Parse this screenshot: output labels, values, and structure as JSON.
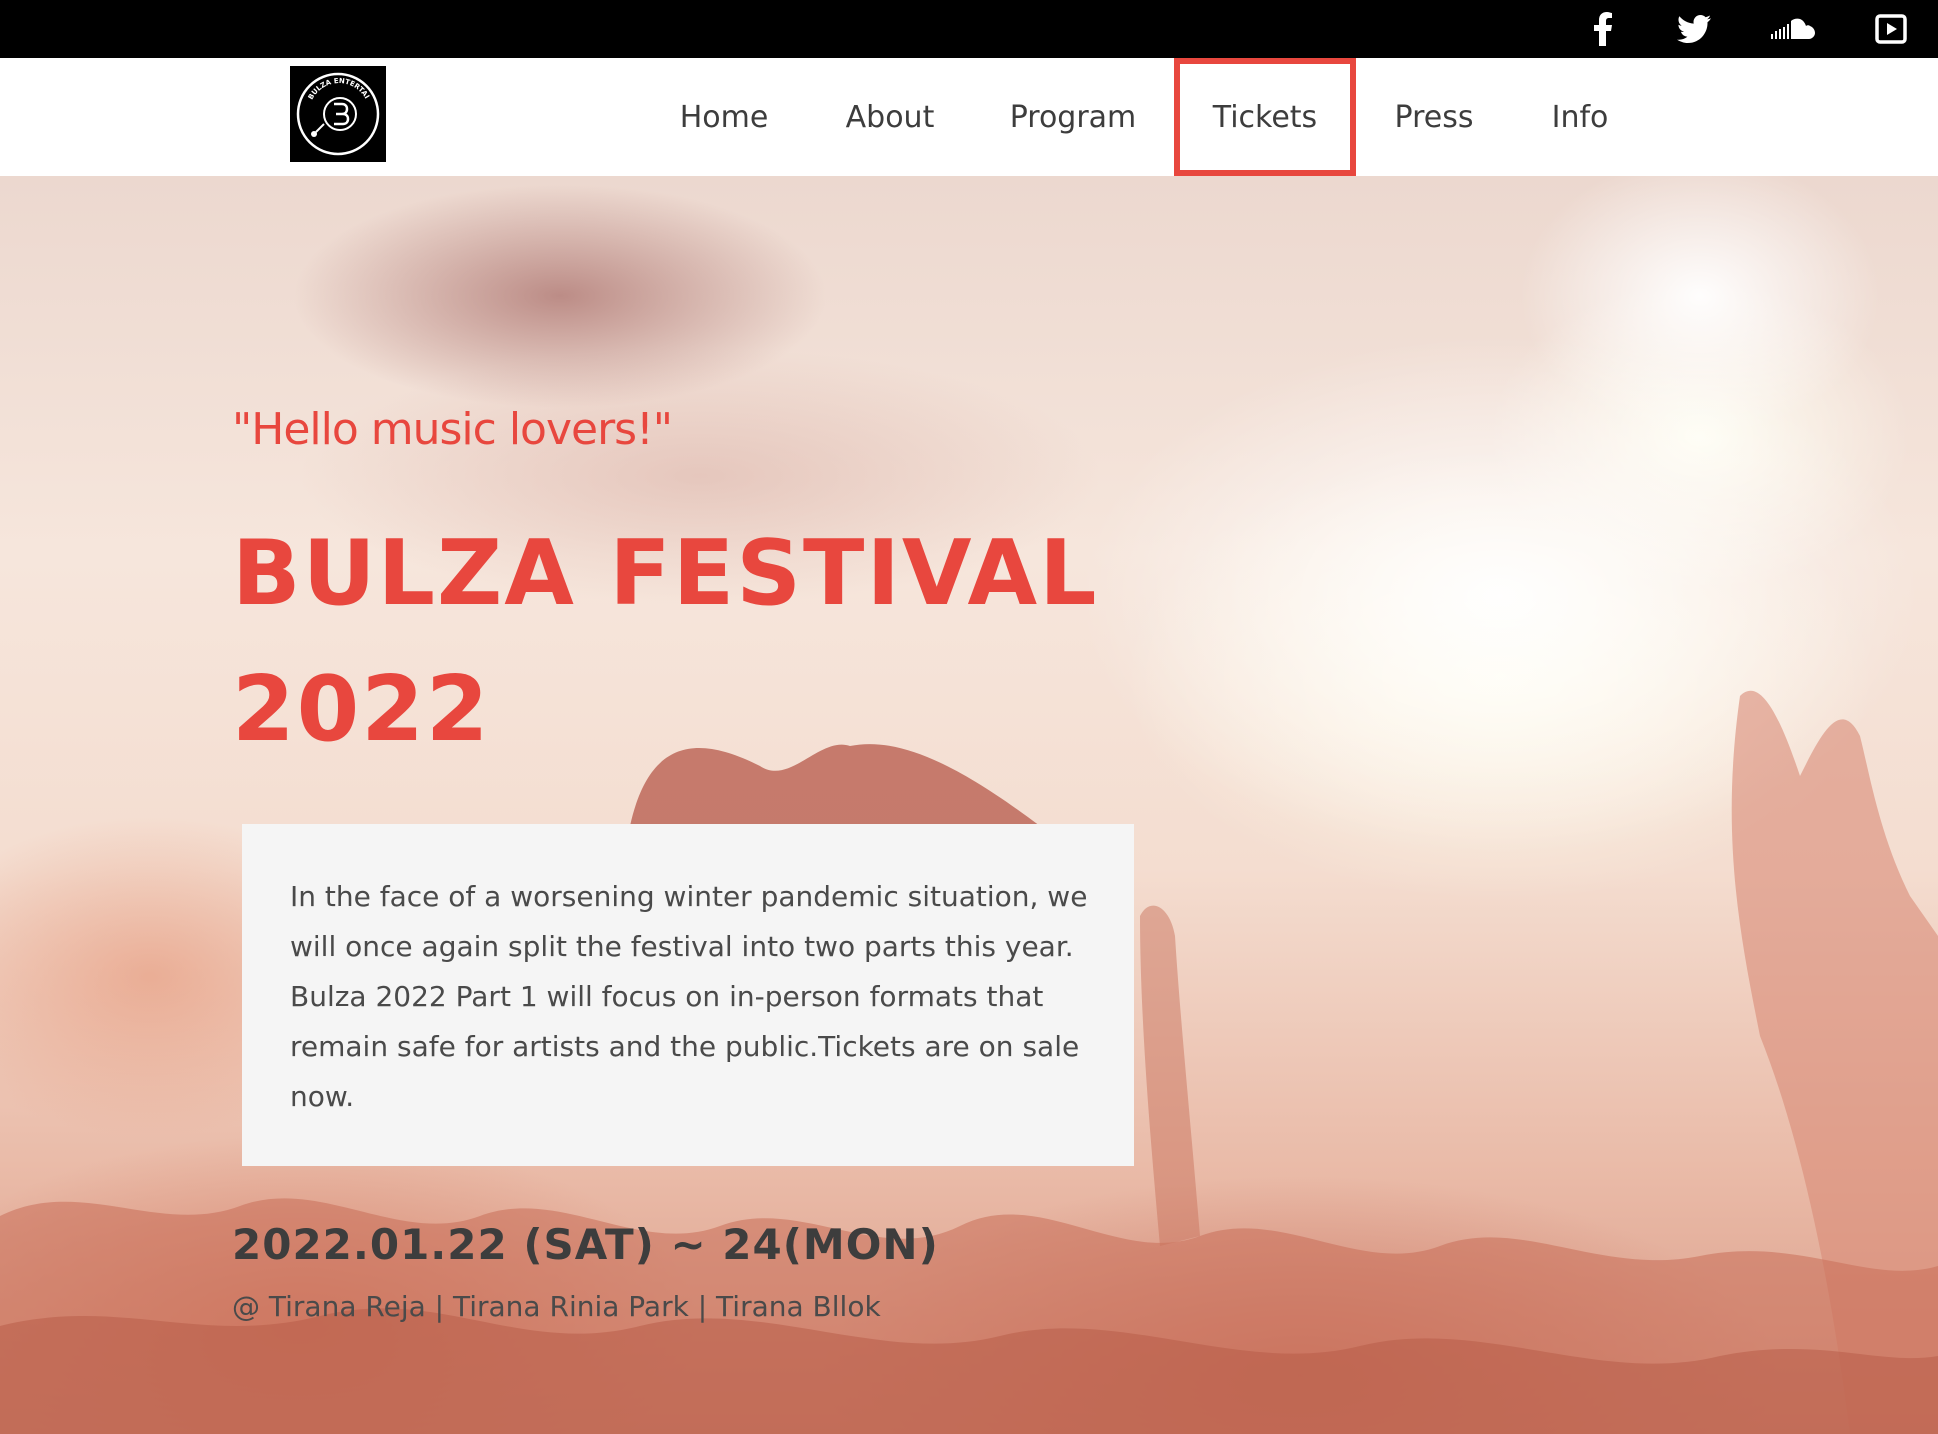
{
  "social": {
    "icons": [
      "facebook-icon",
      "twitter-icon",
      "soundcloud-icon",
      "youtube-icon"
    ]
  },
  "header": {
    "logo_text": "BULZA ENTERTAINMENT",
    "nav": [
      {
        "label": "Home"
      },
      {
        "label": "About"
      },
      {
        "label": "Program"
      },
      {
        "label": "Tickets",
        "active": true
      },
      {
        "label": "Press"
      },
      {
        "label": "Info"
      }
    ]
  },
  "hero": {
    "greeting": "\"Hello music lovers!\"",
    "title_line1": "BULZA FESTIVAL",
    "title_line2": "2022",
    "description": "In the face of a worsening winter pandemic situation, we will once again split the festival into two parts this year. Bulza 2022 Part 1 will focus on in-person formats that remain safe for artists and the public.Tickets are on sale now.",
    "dates": "2022.01.22 (SAT) ~ 24(MON)",
    "venue": "@ Tirana Reja | Tirana Rinia Park | Tirana Bllok"
  },
  "colors": {
    "accent": "#e8473e",
    "topbar": "#000000",
    "text_dark": "#3d3d3d"
  }
}
